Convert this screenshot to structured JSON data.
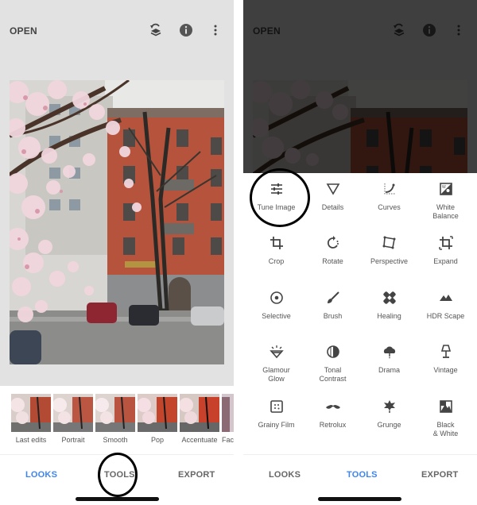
{
  "left_screen": {
    "topbar": {
      "open_label": "OPEN",
      "icons": [
        "layers-undo-icon",
        "info-icon",
        "more-vert-icon"
      ]
    },
    "looks": [
      {
        "label": "Last edits"
      },
      {
        "label": "Portrait"
      },
      {
        "label": "Smooth"
      },
      {
        "label": "Pop"
      },
      {
        "label": "Accentuate"
      },
      {
        "label": "Fac"
      }
    ],
    "bottom_nav": {
      "looks": "LOOKS",
      "tools": "TOOLS",
      "export": "EXPORT",
      "active": "LOOKS",
      "highlighted": "TOOLS"
    }
  },
  "right_screen": {
    "topbar": {
      "open_label": "OPEN"
    },
    "tools": [
      {
        "label": "Tune Image",
        "icon": "tune-icon"
      },
      {
        "label": "Details",
        "icon": "details-triangle-icon"
      },
      {
        "label": "Curves",
        "icon": "curves-icon"
      },
      {
        "label": "White Balance",
        "icon": "white-balance-icon"
      },
      {
        "label": "Crop",
        "icon": "crop-icon"
      },
      {
        "label": "Rotate",
        "icon": "rotate-icon"
      },
      {
        "label": "Perspective",
        "icon": "perspective-icon"
      },
      {
        "label": "Expand",
        "icon": "expand-icon"
      },
      {
        "label": "Selective",
        "icon": "selective-icon"
      },
      {
        "label": "Brush",
        "icon": "brush-icon"
      },
      {
        "label": "Healing",
        "icon": "healing-icon"
      },
      {
        "label": "HDR Scape",
        "icon": "hdr-scape-icon"
      },
      {
        "label": "Glamour Glow",
        "icon": "glamour-glow-icon"
      },
      {
        "label": "Tonal Contrast",
        "icon": "tonal-contrast-icon"
      },
      {
        "label": "Drama",
        "icon": "drama-icon"
      },
      {
        "label": "Vintage",
        "icon": "vintage-lamp-icon"
      },
      {
        "label": "Grainy Film",
        "icon": "grainy-film-icon"
      },
      {
        "label": "Retrolux",
        "icon": "retrolux-mustache-icon"
      },
      {
        "label": "Grunge",
        "icon": "grunge-icon"
      },
      {
        "label": "Black & White",
        "icon": "black-white-icon"
      }
    ],
    "highlighted_tool": "Tune Image",
    "bottom_nav": {
      "looks": "LOOKS",
      "tools": "TOOLS",
      "export": "EXPORT",
      "active": "TOOLS"
    }
  },
  "colors": {
    "accent": "#3d85f0",
    "editor_bg": "#e2e2e2",
    "nav_inactive": "#666666"
  }
}
